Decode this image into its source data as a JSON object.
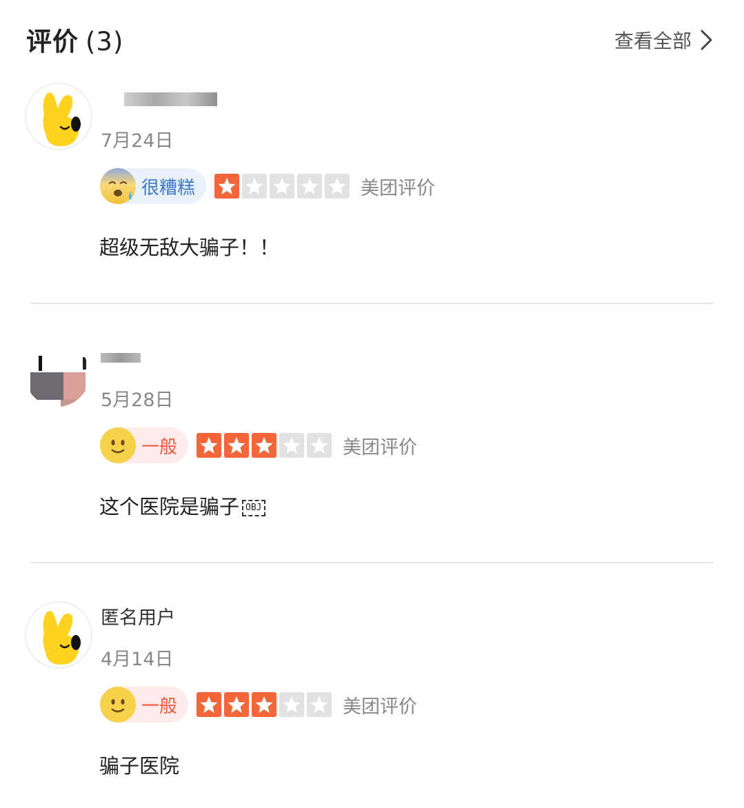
{
  "header": {
    "title": "评价",
    "count": "(3)",
    "view_all": "查看全部"
  },
  "reviews": [
    {
      "username": "",
      "date": "7月24日",
      "mood_label": "很糟糕",
      "stars": 1,
      "source": "美团评价",
      "content": "超级无敌大骗子！！"
    },
    {
      "username": "",
      "date": "5月28日",
      "mood_label": "一般",
      "stars": 3,
      "source": "美团评价",
      "content": "这个医院是骗子",
      "obj_marker": "OBJ"
    },
    {
      "username": "匿名用户",
      "date": "4月14日",
      "mood_label": "一般",
      "stars": 3,
      "source": "美团评价",
      "content": "骗子医院"
    }
  ],
  "colors": {
    "star_on": "#f4663a",
    "star_off": "#e2e2e2",
    "bad_label": "#3f79c4",
    "ok_label": "#ef5a3c"
  },
  "icons": [
    "chevron-right-icon",
    "mascot-avatar-icon",
    "worried-face-icon",
    "smiling-face-icon",
    "star-icon"
  ]
}
